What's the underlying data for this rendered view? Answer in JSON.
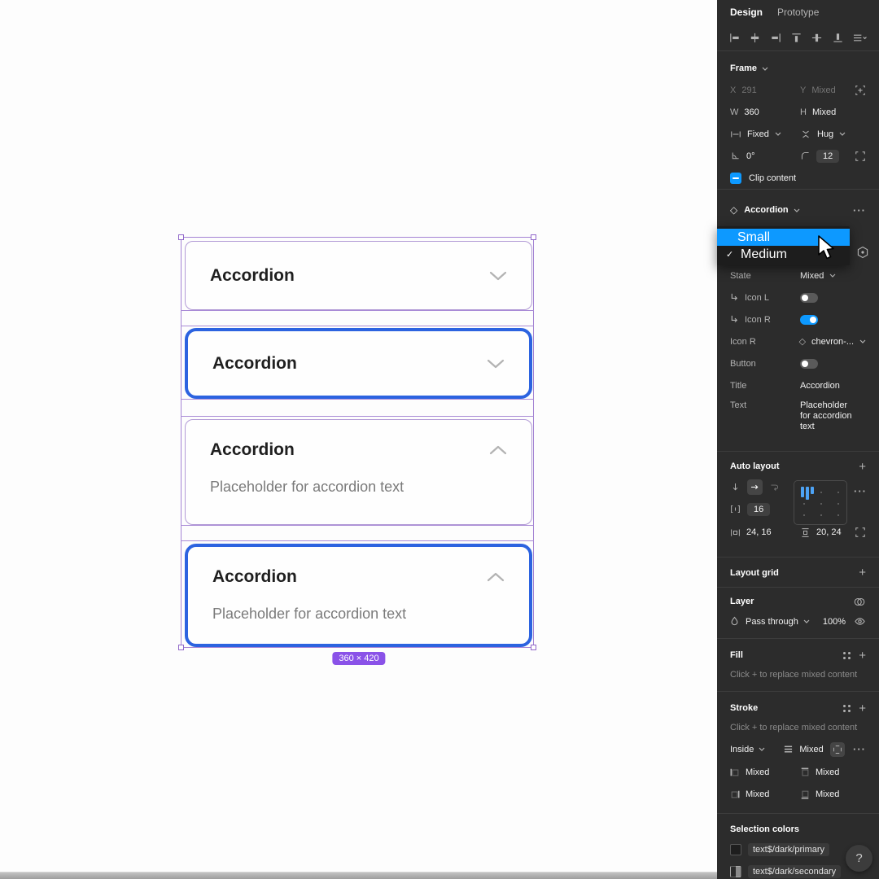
{
  "colors": {
    "accent_blue": "#0d99ff",
    "selection_purple": "#a584d4",
    "component_border_blue": "#2c63e0",
    "badge_purple": "#8a52e8",
    "panel_bg": "#2c2c2c"
  },
  "icons": {
    "diamond": "◇",
    "check": "✓",
    "overflow": "···",
    "plus": "+"
  },
  "canvas": {
    "badge": "360 × 420",
    "accordions": [
      {
        "title": "Accordion",
        "state": "collapsed"
      },
      {
        "title": "Accordion",
        "state": "collapsed"
      },
      {
        "title": "Accordion",
        "body": "Placeholder for accordion text",
        "state": "expanded"
      },
      {
        "title": "Accordion",
        "body": "Placeholder for accordion text",
        "state": "expanded"
      }
    ]
  },
  "panel": {
    "tabs": {
      "design": "Design",
      "prototype": "Prototype"
    },
    "help_label": "?",
    "frame": {
      "header": "Frame",
      "x_label": "X",
      "x_value": "291",
      "y_label": "Y",
      "y_value": "Mixed",
      "w_label": "W",
      "w_value": "360",
      "h_label": "H",
      "h_value": "Mixed",
      "h_sizing": "Fixed",
      "v_sizing": "Hug",
      "rotation": "0°",
      "corner_radius": "12",
      "clip_label": "Clip content"
    },
    "component": {
      "header": "Accordion",
      "menu": [
        {
          "label": "Small",
          "checked": false
        },
        {
          "label": "Medium",
          "checked": true
        }
      ],
      "state_label": "State",
      "state_value": "Mixed",
      "icon_l_label": "Icon L",
      "icon_r_label": "Icon R",
      "icon_r_select_label": "Icon R",
      "icon_r_select_value": "chevron-...",
      "button_label": "Button",
      "title_label": "Title",
      "title_value": "Accordion",
      "text_label": "Text",
      "text_value": "Placeholder for accordion text"
    },
    "auto_layout": {
      "header": "Auto layout",
      "gap": "16",
      "padding_horizontal": "24, 16",
      "padding_vertical": "20, 24"
    },
    "layout_grid": {
      "header": "Layout grid"
    },
    "layer": {
      "header": "Layer",
      "blend_mode": "Pass through",
      "opacity": "100%"
    },
    "fill": {
      "header": "Fill",
      "empty_text": "Click + to replace mixed content"
    },
    "stroke": {
      "header": "Stroke",
      "empty_text": "Click + to replace mixed content",
      "position": "Inside",
      "weight_value": "Mixed",
      "side_values": [
        "Mixed",
        "Mixed",
        "Mixed",
        "Mixed"
      ]
    },
    "selection_colors": {
      "header": "Selection colors",
      "items": [
        "text$/dark/primary",
        "text$/dark/secondary"
      ]
    }
  }
}
